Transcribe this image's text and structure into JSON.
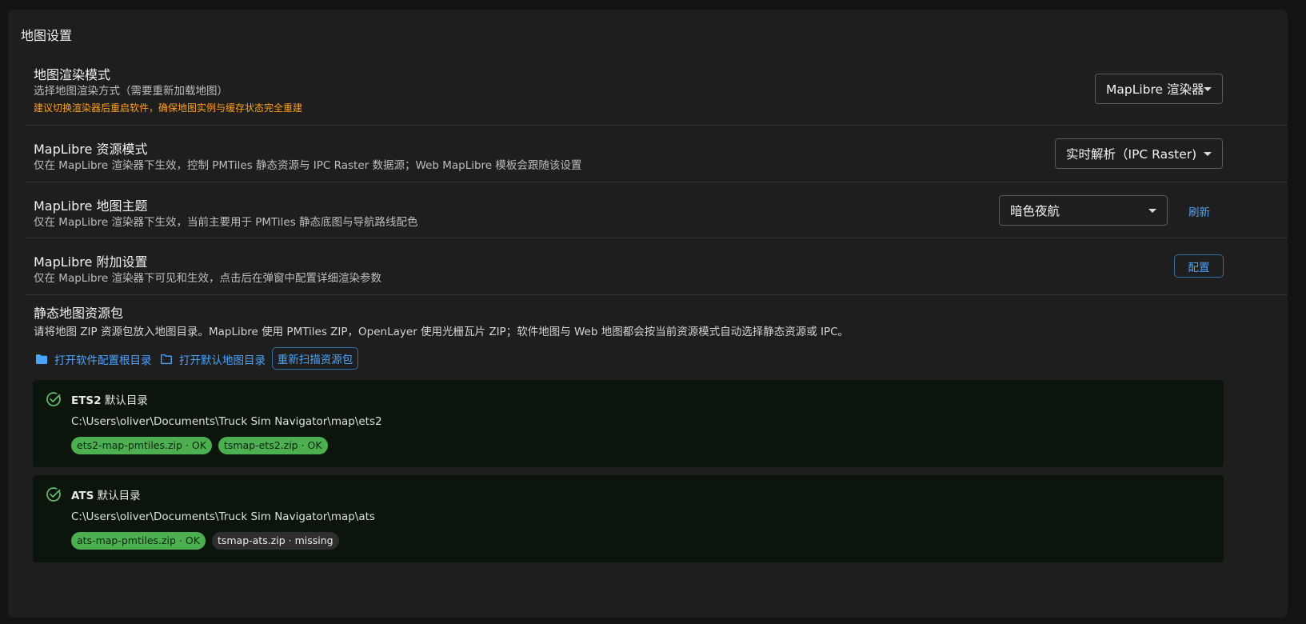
{
  "card_title": "地图设置",
  "render_mode": {
    "title": "地图渲染模式",
    "description": "选择地图渲染方式（需要重新加载地图）",
    "warning": "建议切换渲染器后重启软件，确保地图实例与缓存状态完全重建",
    "selected": "MapLibre 渲染器",
    "warning_color": "#ff9f1a"
  },
  "resource_mode": {
    "title": "MapLibre 资源模式",
    "description": "仅在 MapLibre 渲染器下生效，控制 PMTiles 静态资源与 IPC Raster 数据源；Web MapLibre 模板会跟随该设置",
    "selected": "实时解析（IPC Raster)"
  },
  "theme": {
    "title": "MapLibre 地图主题",
    "description": "仅在 MapLibre 渲染器下生效，当前主要用于 PMTiles 静态底图与导航路线配色",
    "selected": "暗色夜航",
    "refresh_label": "刷新"
  },
  "extra": {
    "title": "MapLibre 附加设置",
    "description": "仅在 MapLibre 渲染器下可见和生效，点击后在弹窗中配置详细渲染参数",
    "config_label": "配置"
  },
  "static_pack": {
    "title": "静态地图资源包",
    "description": "请将地图 ZIP 资源包放入地图目录。MapLibre 使用 PMTiles ZIP，OpenLayer 使用光栅瓦片 ZIP；软件地图与 Web 地图都会按当前资源模式自动选择静态资源或 IPC。",
    "actions": {
      "open_config_root": "打开软件配置根目录",
      "open_default_map_dir": "打开默认地图目录",
      "rescan": "重新扫描资源包"
    },
    "directories": [
      {
        "game": "ETS2",
        "label_suffix": "默认目录",
        "path": "C:\\Users\\oliver\\Documents\\Truck Sim Navigator\\map\\ets2",
        "files": [
          {
            "text": "ets2-map-pmtiles.zip · OK",
            "status": "ok"
          },
          {
            "text": "tsmap-ets2.zip · OK",
            "status": "ok"
          }
        ]
      },
      {
        "game": "ATS",
        "label_suffix": "默认目录",
        "path": "C:\\Users\\oliver\\Documents\\Truck Sim Navigator\\map\\ats",
        "files": [
          {
            "text": "ats-map-pmtiles.zip · OK",
            "status": "ok"
          },
          {
            "text": "tsmap-ats.zip · missing",
            "status": "missing"
          }
        ]
      }
    ]
  },
  "icons": {
    "caret": "chevron-down-icon",
    "folder_filled": "folder-filled-icon",
    "folder_outline": "folder-outline-icon",
    "check_circle": "check-circle-icon"
  },
  "colors": {
    "accent": "#4aa3ff",
    "ok_chip": "#4caf50",
    "ok_check": "#66bb6a"
  }
}
